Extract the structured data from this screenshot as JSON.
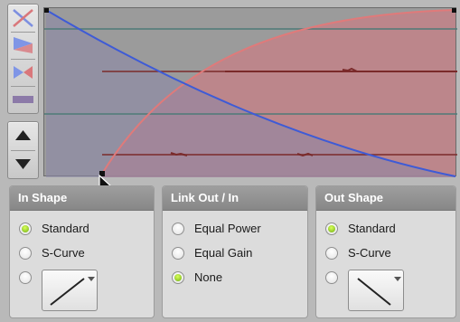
{
  "colors": {
    "graph_bg": "#9b9b9b",
    "in_curve": "#3e5bd6",
    "out_curve": "#e07a7a",
    "out_fill": "#c77f86",
    "in_fill": "#8c84a8",
    "radio_selected": "#7bc41a",
    "header_bg": "#939393"
  },
  "toolbar": {
    "icons": [
      "crossfade-cross-icon",
      "fade-in-icon",
      "fade-out-icon",
      "fade-bar-icon",
      "arrow-up-icon",
      "arrow-down-icon"
    ]
  },
  "panels": {
    "in_shape": {
      "title": "In Shape",
      "options": [
        {
          "label": "Standard",
          "selected": true
        },
        {
          "label": "S-Curve",
          "selected": false
        }
      ],
      "curve_selector_icon": "linear-rising-curve-icon"
    },
    "link": {
      "title": "Link Out / In",
      "options": [
        {
          "label": "Equal Power",
          "selected": false
        },
        {
          "label": "Equal Gain",
          "selected": false
        },
        {
          "label": "None",
          "selected": true
        }
      ]
    },
    "out_shape": {
      "title": "Out Shape",
      "options": [
        {
          "label": "Standard",
          "selected": true
        },
        {
          "label": "S-Curve",
          "selected": false
        }
      ],
      "curve_selector_icon": "linear-falling-curve-icon"
    }
  },
  "cursor": "arrow-pointer-icon"
}
